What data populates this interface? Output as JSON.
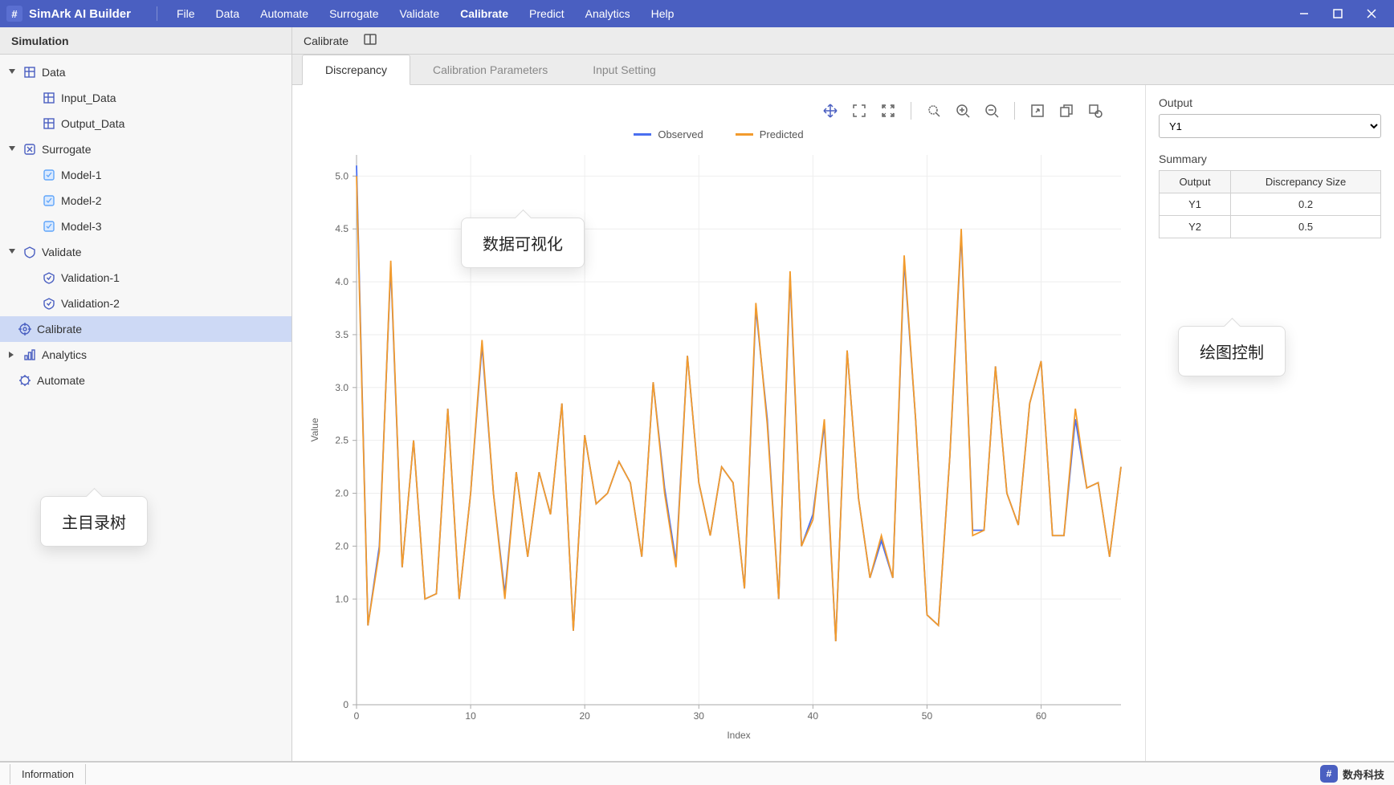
{
  "title": "SimArk AI Builder",
  "menu": [
    "File",
    "Data",
    "Automate",
    "Surrogate",
    "Validate",
    "Calibrate",
    "Predict",
    "Analytics",
    "Help"
  ],
  "active_menu": "Calibrate",
  "left_title": "Simulation",
  "sub_title": "Calibrate",
  "tree": {
    "data": "Data",
    "input_data": "Input_Data",
    "output_data": "Output_Data",
    "surrogate": "Surrogate",
    "model1": "Model-1",
    "model2": "Model-2",
    "model3": "Model-3",
    "validate": "Validate",
    "val1": "Validation-1",
    "val2": "Validation-2",
    "calibrate": "Calibrate",
    "analytics": "Analytics",
    "automate": "Automate"
  },
  "tabs": {
    "discrepancy": "Discrepancy",
    "calib_params": "Calibration Parameters",
    "input_setting": "Input Setting"
  },
  "legend": {
    "observed": "Observed",
    "predicted": "Predicted"
  },
  "axes": {
    "x": "Index",
    "y": "Value"
  },
  "right": {
    "output_label": "Output",
    "output_value": "Y1",
    "summary_label": "Summary",
    "headers": {
      "output": "Output",
      "disc": "Discrepancy Size"
    },
    "rows": [
      {
        "o": "Y1",
        "d": "0.2"
      },
      {
        "o": "Y2",
        "d": "0.5"
      }
    ]
  },
  "status": {
    "info": "Information",
    "brand": "数舟科技"
  },
  "callouts": {
    "tree": "主目录树",
    "viz": "数据可视化",
    "plot_ctrl": "绘图控制"
  },
  "colors": {
    "observed": "#4a6ff0",
    "predicted": "#f29b2d"
  },
  "chart_data": {
    "type": "line",
    "x": [
      0,
      1,
      2,
      3,
      4,
      5,
      6,
      7,
      8,
      9,
      10,
      11,
      12,
      13,
      14,
      15,
      16,
      17,
      18,
      19,
      20,
      21,
      22,
      23,
      24,
      25,
      26,
      27,
      28,
      29,
      30,
      31,
      32,
      33,
      34,
      35,
      36,
      37,
      38,
      39,
      40,
      41,
      42,
      43,
      44,
      45,
      46,
      47,
      48,
      49,
      50,
      51,
      52,
      53,
      54,
      55,
      56,
      57,
      58,
      59,
      60,
      61,
      62,
      63,
      64,
      65,
      66,
      67
    ],
    "series": [
      {
        "name": "Observed",
        "values": [
          5.1,
          0.75,
          1.5,
          4.15,
          1.3,
          2.5,
          1.0,
          1.05,
          2.8,
          1.0,
          2.0,
          3.4,
          2.0,
          1.05,
          2.2,
          1.4,
          2.2,
          1.8,
          2.85,
          0.7,
          2.55,
          1.9,
          2.0,
          2.3,
          2.1,
          1.4,
          3.05,
          2.05,
          1.35,
          3.3,
          2.1,
          1.6,
          2.25,
          2.1,
          1.1,
          3.75,
          2.7,
          1.0,
          4.05,
          1.5,
          1.8,
          2.65,
          0.6,
          3.35,
          1.95,
          1.2,
          1.55,
          1.2,
          4.2,
          2.7,
          0.85,
          0.75,
          2.35,
          4.45,
          1.65,
          1.65,
          3.2,
          2.0,
          1.7,
          2.85,
          3.25,
          1.6,
          1.6,
          2.7,
          2.05,
          2.1,
          1.4,
          2.25
        ]
      },
      {
        "name": "Predicted",
        "values": [
          5.0,
          0.75,
          1.45,
          4.2,
          1.3,
          2.5,
          1.0,
          1.05,
          2.8,
          1.0,
          2.0,
          3.45,
          2.0,
          1.0,
          2.2,
          1.4,
          2.2,
          1.8,
          2.85,
          0.7,
          2.55,
          1.9,
          2.0,
          2.3,
          2.1,
          1.4,
          3.05,
          2.0,
          1.3,
          3.3,
          2.1,
          1.6,
          2.25,
          2.1,
          1.1,
          3.8,
          2.65,
          1.0,
          4.1,
          1.5,
          1.75,
          2.7,
          0.6,
          3.35,
          1.95,
          1.2,
          1.6,
          1.2,
          4.25,
          2.7,
          0.85,
          0.75,
          2.35,
          4.5,
          1.6,
          1.65,
          3.2,
          2.0,
          1.7,
          2.85,
          3.25,
          1.6,
          1.6,
          2.8,
          2.05,
          2.1,
          1.4,
          2.25
        ]
      }
    ],
    "title": "",
    "xlabel": "Index",
    "ylabel": "Value",
    "xlim": [
      0,
      67
    ],
    "ylim": [
      0,
      5.2
    ],
    "xticks": [
      0,
      10,
      20,
      30,
      40,
      50,
      60
    ],
    "yticks": [
      0,
      1.0,
      2.0,
      2.0,
      2.5,
      3.0,
      3.5,
      4.0,
      4.5,
      5.0
    ]
  }
}
